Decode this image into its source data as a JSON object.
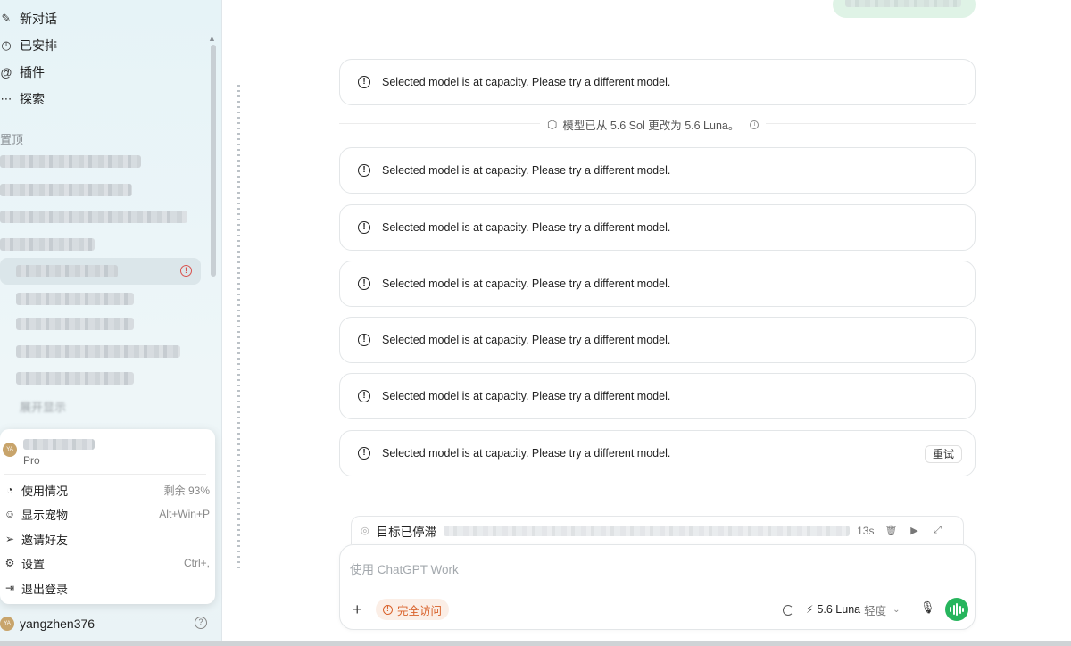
{
  "sidebar": {
    "nav": [
      {
        "label": "新对话",
        "icon": "edit-icon"
      },
      {
        "label": "已安排",
        "icon": "clock-icon"
      },
      {
        "label": "插件",
        "icon": "plugin-icon"
      },
      {
        "label": "探索",
        "icon": "more-icon"
      }
    ],
    "pinned_title": "置顶",
    "show_more": "展开显示",
    "user_name": "yangzhen376",
    "avatar_initials": "YA"
  },
  "account_menu": {
    "plan": "Pro",
    "items": [
      {
        "label": "使用情况",
        "hint": "剩余 93%",
        "icon": "gauge-icon"
      },
      {
        "label": "显示宠物",
        "hint": "Alt+Win+P",
        "icon": "pet-icon"
      },
      {
        "label": "邀请好友",
        "hint": "",
        "icon": "send-icon"
      },
      {
        "label": "设置",
        "hint": "Ctrl+,",
        "icon": "gear-icon"
      },
      {
        "label": "退出登录",
        "hint": "",
        "icon": "logout-icon"
      }
    ]
  },
  "chat": {
    "error_text": "Selected model is at capacity. Please try a different model.",
    "model_change_notice": "模型已从 5.6 Sol 更改为 5.6 Luna。",
    "retry_label": "重试",
    "goal_status": "目标已停滞",
    "goal_elapsed": "13s"
  },
  "composer": {
    "placeholder": "使用 ChatGPT Work",
    "access_label": "完全访问",
    "model_label": "5.6 Luna",
    "effort_label": "轻度"
  },
  "colors": {
    "accent_green": "#27b55d",
    "warning_orange": "#d9622b",
    "sidebar_bg": "#e6f3f7"
  }
}
